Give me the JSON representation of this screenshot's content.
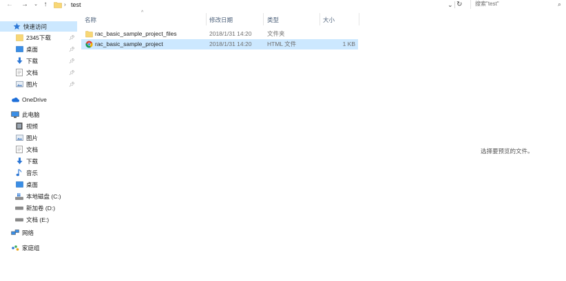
{
  "address_bar": {
    "back_icon": "back-arrow-icon",
    "forward_icon": "forward-arrow-icon",
    "recent_icon": "chevron-down-icon",
    "up_icon": "up-arrow-icon",
    "breadcrumb_separator": "›",
    "path": "test",
    "dropdown_glyph": "⌄",
    "refresh_glyph": "↻",
    "search_placeholder": "搜索\"test\""
  },
  "sidebar": {
    "quick_access": {
      "label": "快速访问",
      "icon": "star-icon"
    },
    "quick_items": [
      {
        "label": "2345下载",
        "icon": "folder-icon",
        "pinned": true
      },
      {
        "label": "桌面",
        "icon": "desktop-icon",
        "pinned": true
      },
      {
        "label": "下载",
        "icon": "download-icon",
        "pinned": true
      },
      {
        "label": "文档",
        "icon": "document-icon",
        "pinned": true
      },
      {
        "label": "图片",
        "icon": "picture-icon",
        "pinned": true
      }
    ],
    "onedrive": {
      "label": "OneDrive",
      "icon": "cloud-icon"
    },
    "this_pc": {
      "label": "此电脑",
      "icon": "computer-icon"
    },
    "pc_items": [
      {
        "label": "视频",
        "icon": "video-icon"
      },
      {
        "label": "图片",
        "icon": "picture-icon"
      },
      {
        "label": "文档",
        "icon": "document-icon"
      },
      {
        "label": "下载",
        "icon": "download-icon"
      },
      {
        "label": "音乐",
        "icon": "music-icon"
      },
      {
        "label": "桌面",
        "icon": "desktop-icon"
      },
      {
        "label": "本地磁盘 (C:)",
        "icon": "system-drive-icon"
      },
      {
        "label": "新加卷 (D:)",
        "icon": "drive-icon"
      },
      {
        "label": "文档 (E:)",
        "icon": "drive-icon"
      }
    ],
    "network": {
      "label": "网络",
      "icon": "network-icon"
    },
    "homegroup": {
      "label": "家庭组",
      "icon": "homegroup-icon"
    }
  },
  "columns": {
    "name": "名称",
    "date": "修改日期",
    "type": "类型",
    "size": "大小"
  },
  "files": [
    {
      "name": "rac_basic_sample_project_files",
      "date": "2018/1/31 14:20",
      "type": "文件夹",
      "size": "",
      "icon": "folder-icon",
      "selected": false
    },
    {
      "name": "rac_basic_sample_project",
      "date": "2018/1/31 14:20",
      "type": "HTML 文件",
      "size": "1 KB",
      "icon": "chrome-icon",
      "selected": true
    }
  ],
  "preview_pane": {
    "message": "选择要预览的文件。"
  },
  "colors": {
    "selection": "#cce8ff",
    "folder_yellow": "#f8d775",
    "accent_blue": "#1e6fd9",
    "header_text": "#4c607a"
  }
}
